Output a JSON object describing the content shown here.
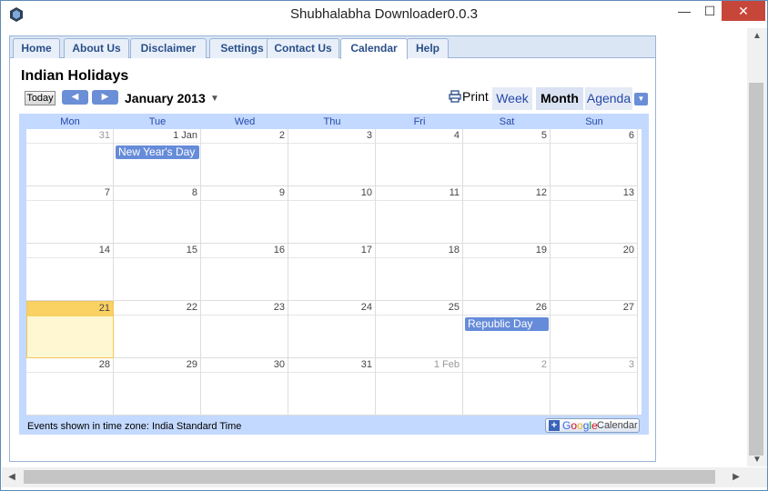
{
  "window": {
    "title": "Shubhalabha Downloader0.0.3",
    "minimize_glyph": "—",
    "maximize_glyph": "☐",
    "close_glyph": "✕"
  },
  "nav": {
    "tabs": [
      "Home",
      "About Us",
      "Disclaimer",
      "Settings",
      "Contact Us",
      "Calendar",
      "Help"
    ],
    "active": "Calendar"
  },
  "calendar": {
    "title": "Indian Holidays",
    "today_label": "Today",
    "prev_glyph": "◀",
    "next_glyph": "▶",
    "month_label": "January 2013",
    "print_label": "Print",
    "views": {
      "week": "Week",
      "month": "Month",
      "agenda": "Agenda"
    },
    "active_view": "Month",
    "weekdays": [
      "Mon",
      "Tue",
      "Wed",
      "Thu",
      "Fri",
      "Sat",
      "Sun"
    ],
    "weeks": [
      [
        {
          "d": "31",
          "other": true
        },
        {
          "d": "1 Jan"
        },
        {
          "d": "2"
        },
        {
          "d": "3"
        },
        {
          "d": "4"
        },
        {
          "d": "5"
        },
        {
          "d": "6"
        }
      ],
      [
        {
          "d": "7"
        },
        {
          "d": "8"
        },
        {
          "d": "9"
        },
        {
          "d": "10"
        },
        {
          "d": "11"
        },
        {
          "d": "12"
        },
        {
          "d": "13"
        }
      ],
      [
        {
          "d": "14"
        },
        {
          "d": "15"
        },
        {
          "d": "16"
        },
        {
          "d": "17"
        },
        {
          "d": "18"
        },
        {
          "d": "19"
        },
        {
          "d": "20"
        }
      ],
      [
        {
          "d": "21",
          "today": true
        },
        {
          "d": "22"
        },
        {
          "d": "23"
        },
        {
          "d": "24"
        },
        {
          "d": "25"
        },
        {
          "d": "26"
        },
        {
          "d": "27"
        }
      ],
      [
        {
          "d": "28"
        },
        {
          "d": "29"
        },
        {
          "d": "30"
        },
        {
          "d": "31"
        },
        {
          "d": "1 Feb",
          "other": true
        },
        {
          "d": "2",
          "other": true
        },
        {
          "d": "3",
          "other": true
        }
      ]
    ],
    "events": [
      {
        "week": 0,
        "day": 1,
        "title": "New Year's Day"
      },
      {
        "week": 3,
        "day": 5,
        "title": "Republic Day"
      }
    ],
    "timezone_text": "Events shown in time zone: India Standard Time",
    "gcal": {
      "google": "Google",
      "calendar": "Calendar"
    }
  },
  "colors": {
    "accent": "#668cd9",
    "today_header": "#fad163",
    "grid_frame": "#c3d9ff"
  }
}
